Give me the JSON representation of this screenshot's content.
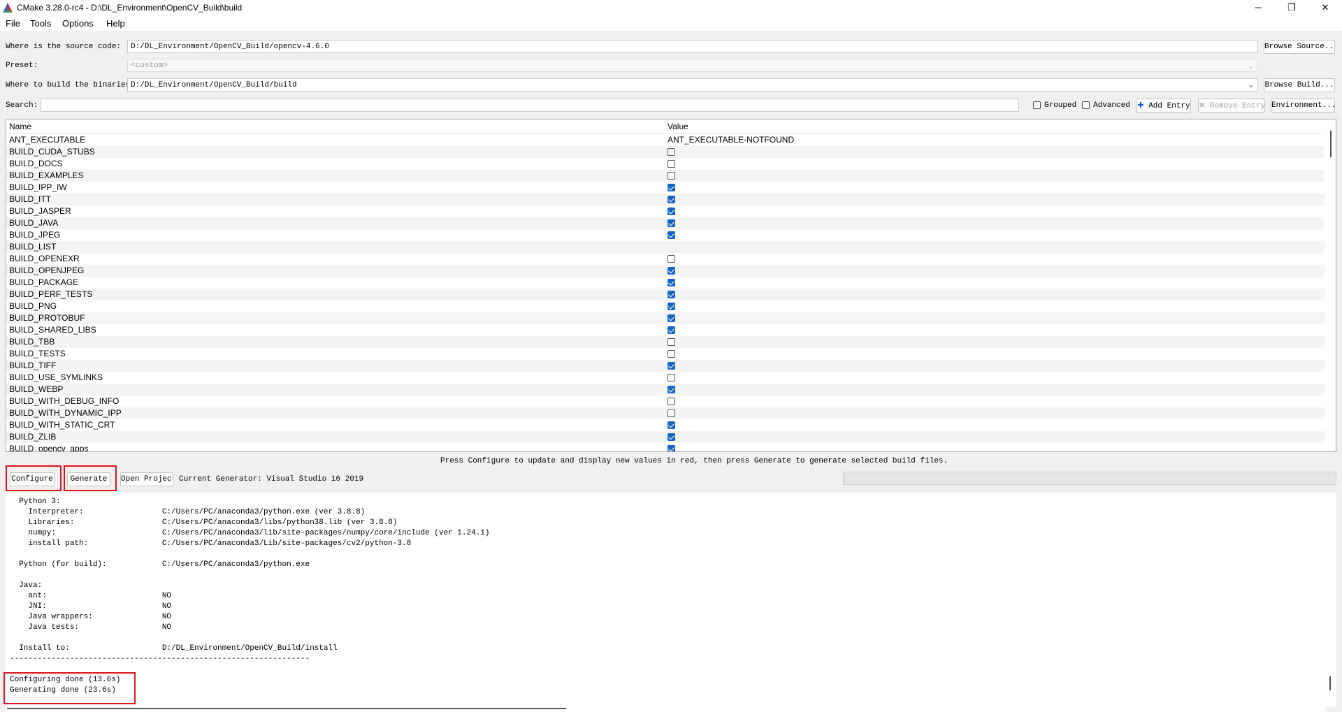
{
  "window": {
    "title": "CMake 3.28.0-rc4 - D:\\DL_Environment\\OpenCV_Build\\build",
    "minimize": "─",
    "maximize": "❐",
    "close": "✕"
  },
  "menu": [
    "File",
    "Tools",
    "Options",
    "Help"
  ],
  "paths": {
    "source_label": "Where is the source code:",
    "source_value": "D:/DL_Environment/OpenCV_Build/opencv-4.6.0",
    "browse_source": "Browse Source...",
    "preset_label": "Preset:",
    "preset_value": "<custom>",
    "build_label": "Where to build the binaries:",
    "build_value": "D:/DL_Environment/OpenCV_Build/build",
    "browse_build": "Browse Build..."
  },
  "search": {
    "label": "Search:",
    "value": "",
    "grouped_label": "Grouped",
    "grouped_checked": false,
    "advanced_label": "Advanced",
    "advanced_checked": false,
    "add_entry": "Add Entry",
    "remove_entry": "Remove Entry",
    "environment": "Environment..."
  },
  "table": {
    "columns": [
      "Name",
      "Value"
    ],
    "rows": [
      {
        "name": "ANT_EXECUTABLE",
        "type": "text",
        "value": "ANT_EXECUTABLE-NOTFOUND"
      },
      {
        "name": "BUILD_CUDA_STUBS",
        "type": "bool",
        "value": false
      },
      {
        "name": "BUILD_DOCS",
        "type": "bool",
        "value": false
      },
      {
        "name": "BUILD_EXAMPLES",
        "type": "bool",
        "value": false
      },
      {
        "name": "BUILD_IPP_IW",
        "type": "bool",
        "value": true
      },
      {
        "name": "BUILD_ITT",
        "type": "bool",
        "value": true
      },
      {
        "name": "BUILD_JASPER",
        "type": "bool",
        "value": true
      },
      {
        "name": "BUILD_JAVA",
        "type": "bool",
        "value": true
      },
      {
        "name": "BUILD_JPEG",
        "type": "bool",
        "value": true
      },
      {
        "name": "BUILD_LIST",
        "type": "text",
        "value": ""
      },
      {
        "name": "BUILD_OPENEXR",
        "type": "bool",
        "value": false
      },
      {
        "name": "BUILD_OPENJPEG",
        "type": "bool",
        "value": true
      },
      {
        "name": "BUILD_PACKAGE",
        "type": "bool",
        "value": true
      },
      {
        "name": "BUILD_PERF_TESTS",
        "type": "bool",
        "value": true
      },
      {
        "name": "BUILD_PNG",
        "type": "bool",
        "value": true
      },
      {
        "name": "BUILD_PROTOBUF",
        "type": "bool",
        "value": true
      },
      {
        "name": "BUILD_SHARED_LIBS",
        "type": "bool",
        "value": true
      },
      {
        "name": "BUILD_TBB",
        "type": "bool",
        "value": false
      },
      {
        "name": "BUILD_TESTS",
        "type": "bool",
        "value": false
      },
      {
        "name": "BUILD_TIFF",
        "type": "bool",
        "value": true
      },
      {
        "name": "BUILD_USE_SYMLINKS",
        "type": "bool",
        "value": false
      },
      {
        "name": "BUILD_WEBP",
        "type": "bool",
        "value": true
      },
      {
        "name": "BUILD_WITH_DEBUG_INFO",
        "type": "bool",
        "value": false
      },
      {
        "name": "BUILD_WITH_DYNAMIC_IPP",
        "type": "bool",
        "value": false
      },
      {
        "name": "BUILD_WITH_STATIC_CRT",
        "type": "bool",
        "value": true
      },
      {
        "name": "BUILD_ZLIB",
        "type": "bool",
        "value": true
      },
      {
        "name": "BUILD_opencv_apps",
        "type": "bool",
        "value": true
      }
    ]
  },
  "hint": "Press Configure to update and display new values in red, then press Generate to generate selected build files.",
  "actions": {
    "configure": "Configure",
    "generate": "Generate",
    "open_project": "Open Project",
    "generator": "Current Generator: Visual Studio 16 2019"
  },
  "output_lines": [
    "  Python 3:",
    "    Interpreter:                 C:/Users/PC/anaconda3/python.exe (ver 3.8.8)",
    "    Libraries:                   C:/Users/PC/anaconda3/libs/python38.lib (ver 3.8.8)",
    "    numpy:                       C:/Users/PC/anaconda3/lib/site-packages/numpy/core/include (ver 1.24.1)",
    "    install path:                C:/Users/PC/anaconda3/Lib/site-packages/cv2/python-3.8",
    "",
    "  Python (for build):            C:/Users/PC/anaconda3/python.exe",
    "",
    "  Java:",
    "    ant:                         NO",
    "    JNI:                         NO",
    "    Java wrappers:               NO",
    "    Java tests:                  NO",
    "",
    "  Install to:                    D:/DL_Environment/OpenCV_Build/install",
    "-----------------------------------------------------------------",
    "",
    "Configuring done (13.6s)",
    "Generating done (23.6s)"
  ],
  "accent_color": "#1366c6",
  "highlight_color": "#e0141e"
}
